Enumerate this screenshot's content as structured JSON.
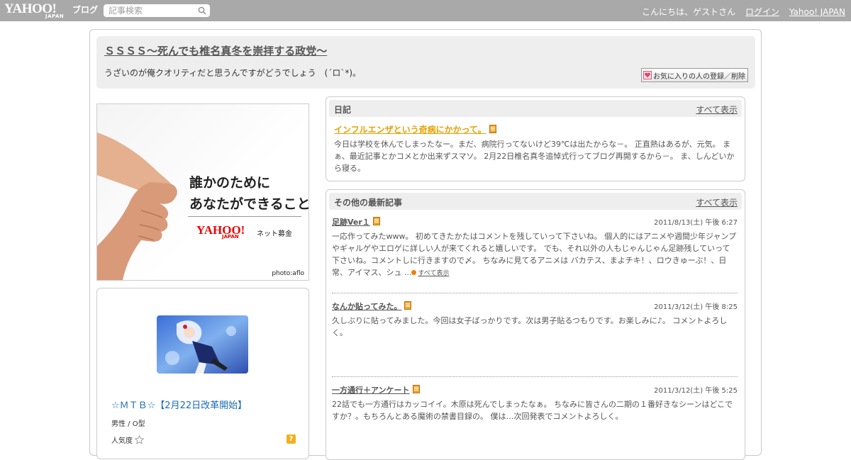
{
  "topbar": {
    "logo_main": "YAHOO!",
    "logo_sub": "JAPAN",
    "logo_blog": "ブログ",
    "search_placeholder": "記事検索",
    "greeting": "こんにちは、ゲストさん",
    "login": "ログイン",
    "yahoo_japan": "Yahoo! JAPAN"
  },
  "header": {
    "title": "ＳＳＳＳ～死んでも椎名真冬を崇拝する政党～",
    "description": "うざいのが俺クオリティだと思うんですがどうでしょう　(´ロ`*)。",
    "fav_button": "お気に入りの人の登録／削除"
  },
  "ad": {
    "line1": "誰かのために",
    "line2": "あなたができること",
    "logo": "YAHOO!",
    "logo_sub": "JAPAN",
    "net_fund": "ネット募金",
    "credit": "photo:aflo"
  },
  "profile": {
    "name": "☆ＭＴＢ☆【2月22日改革開始】",
    "sex_blood": "男性 / O型",
    "popularity_label": "人気度",
    "help": "?"
  },
  "diary": {
    "heading": "日記",
    "view_all": "すべて表示",
    "title": "インフルエンザという奇病にかかって。",
    "body": "今日は学校を休んでしまったなー。まだ、病院行ってないけど39℃は出たからな－。 正直熱はあるが、元気。 まぁ、最近記事とかコメとか出来ずスマソ。 2月22日椎名真冬追悼式行ってブログ再開するから－。 ま、しんどいから寝る。"
  },
  "latest": {
    "heading": "その他の最新記事",
    "view_all": "すべて表示",
    "more": "すべて表示",
    "articles": [
      {
        "title": "足跡Ver１",
        "date": "2011/8/13(土) 午後 6:27",
        "body": "一応作ってみたwww。 初めてきたかたはコメントを残していって下さいね。 個人的にはアニメや週間少年ジャンプやギャルゲやエロゲに詳しい人が来てくれると嬉しいです。 でも、それ以外の人もじゃんじゃん足跡残していって下さいね。コメントしに行きますので〆。 ちなみに見てるアニメは バカテス、まよチキ！、ロウきゅーぶ！、日常、アイマス、シュ ..."
      },
      {
        "title": "なんか貼ってみた。",
        "date": "2011/3/12(土) 午後 8:25",
        "body": "久しぶりに貼ってみました。今回は女子ばっかりです。次は男子貼るつもりです。お楽しみに♪。 コメントよろしく。"
      },
      {
        "title": "一方通行＋アンケート",
        "date": "2011/3/12(土) 午後 5:25",
        "body": "22話でも一方通行はカッコイイ。木原は死んでしまったなぁ。 ちなみに皆さんの二期の１番好きなシーンはどこですか？。もちろんとある魔術の禁書目録の。 僕は…次回発表でコメントよろしく。"
      }
    ]
  }
}
